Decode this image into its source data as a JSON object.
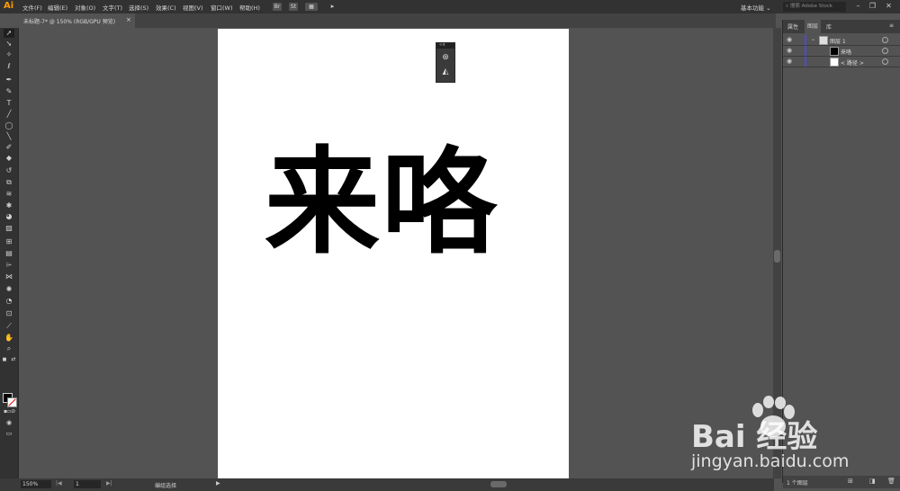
{
  "app": {
    "logo": "Ai"
  },
  "menu": [
    "文件(F)",
    "编辑(E)",
    "对象(O)",
    "文字(T)",
    "选择(S)",
    "效果(C)",
    "视图(V)",
    "窗口(W)",
    "帮助(H)"
  ],
  "toolbar_icons": {
    "bridge": "Br",
    "stock": "St"
  },
  "workspace": {
    "label": "基本功能"
  },
  "stock_search": {
    "placeholder": "搜索 Adobe Stock"
  },
  "document_tab": {
    "title": "未标题-7* @ 150% (RGB/GPU 预览)",
    "close": "×"
  },
  "canvas": {
    "text": "来咯"
  },
  "panel": {
    "tabs": [
      "属性",
      "图层",
      "库"
    ],
    "active_tab": "图层",
    "layers": [
      {
        "name": "图层 1"
      },
      {
        "name": "来咯"
      },
      {
        "name": "< 路径 >"
      }
    ],
    "footer": "1 个图层"
  },
  "status": {
    "zoom": "150%",
    "artboard": "1",
    "tool": "编组选择"
  },
  "watermark": {
    "brand": "Bai 经验",
    "url": "jingyan.baidu.com"
  },
  "colors": {
    "accent": "#ff9a00",
    "layer_color": "#4a4adc"
  }
}
